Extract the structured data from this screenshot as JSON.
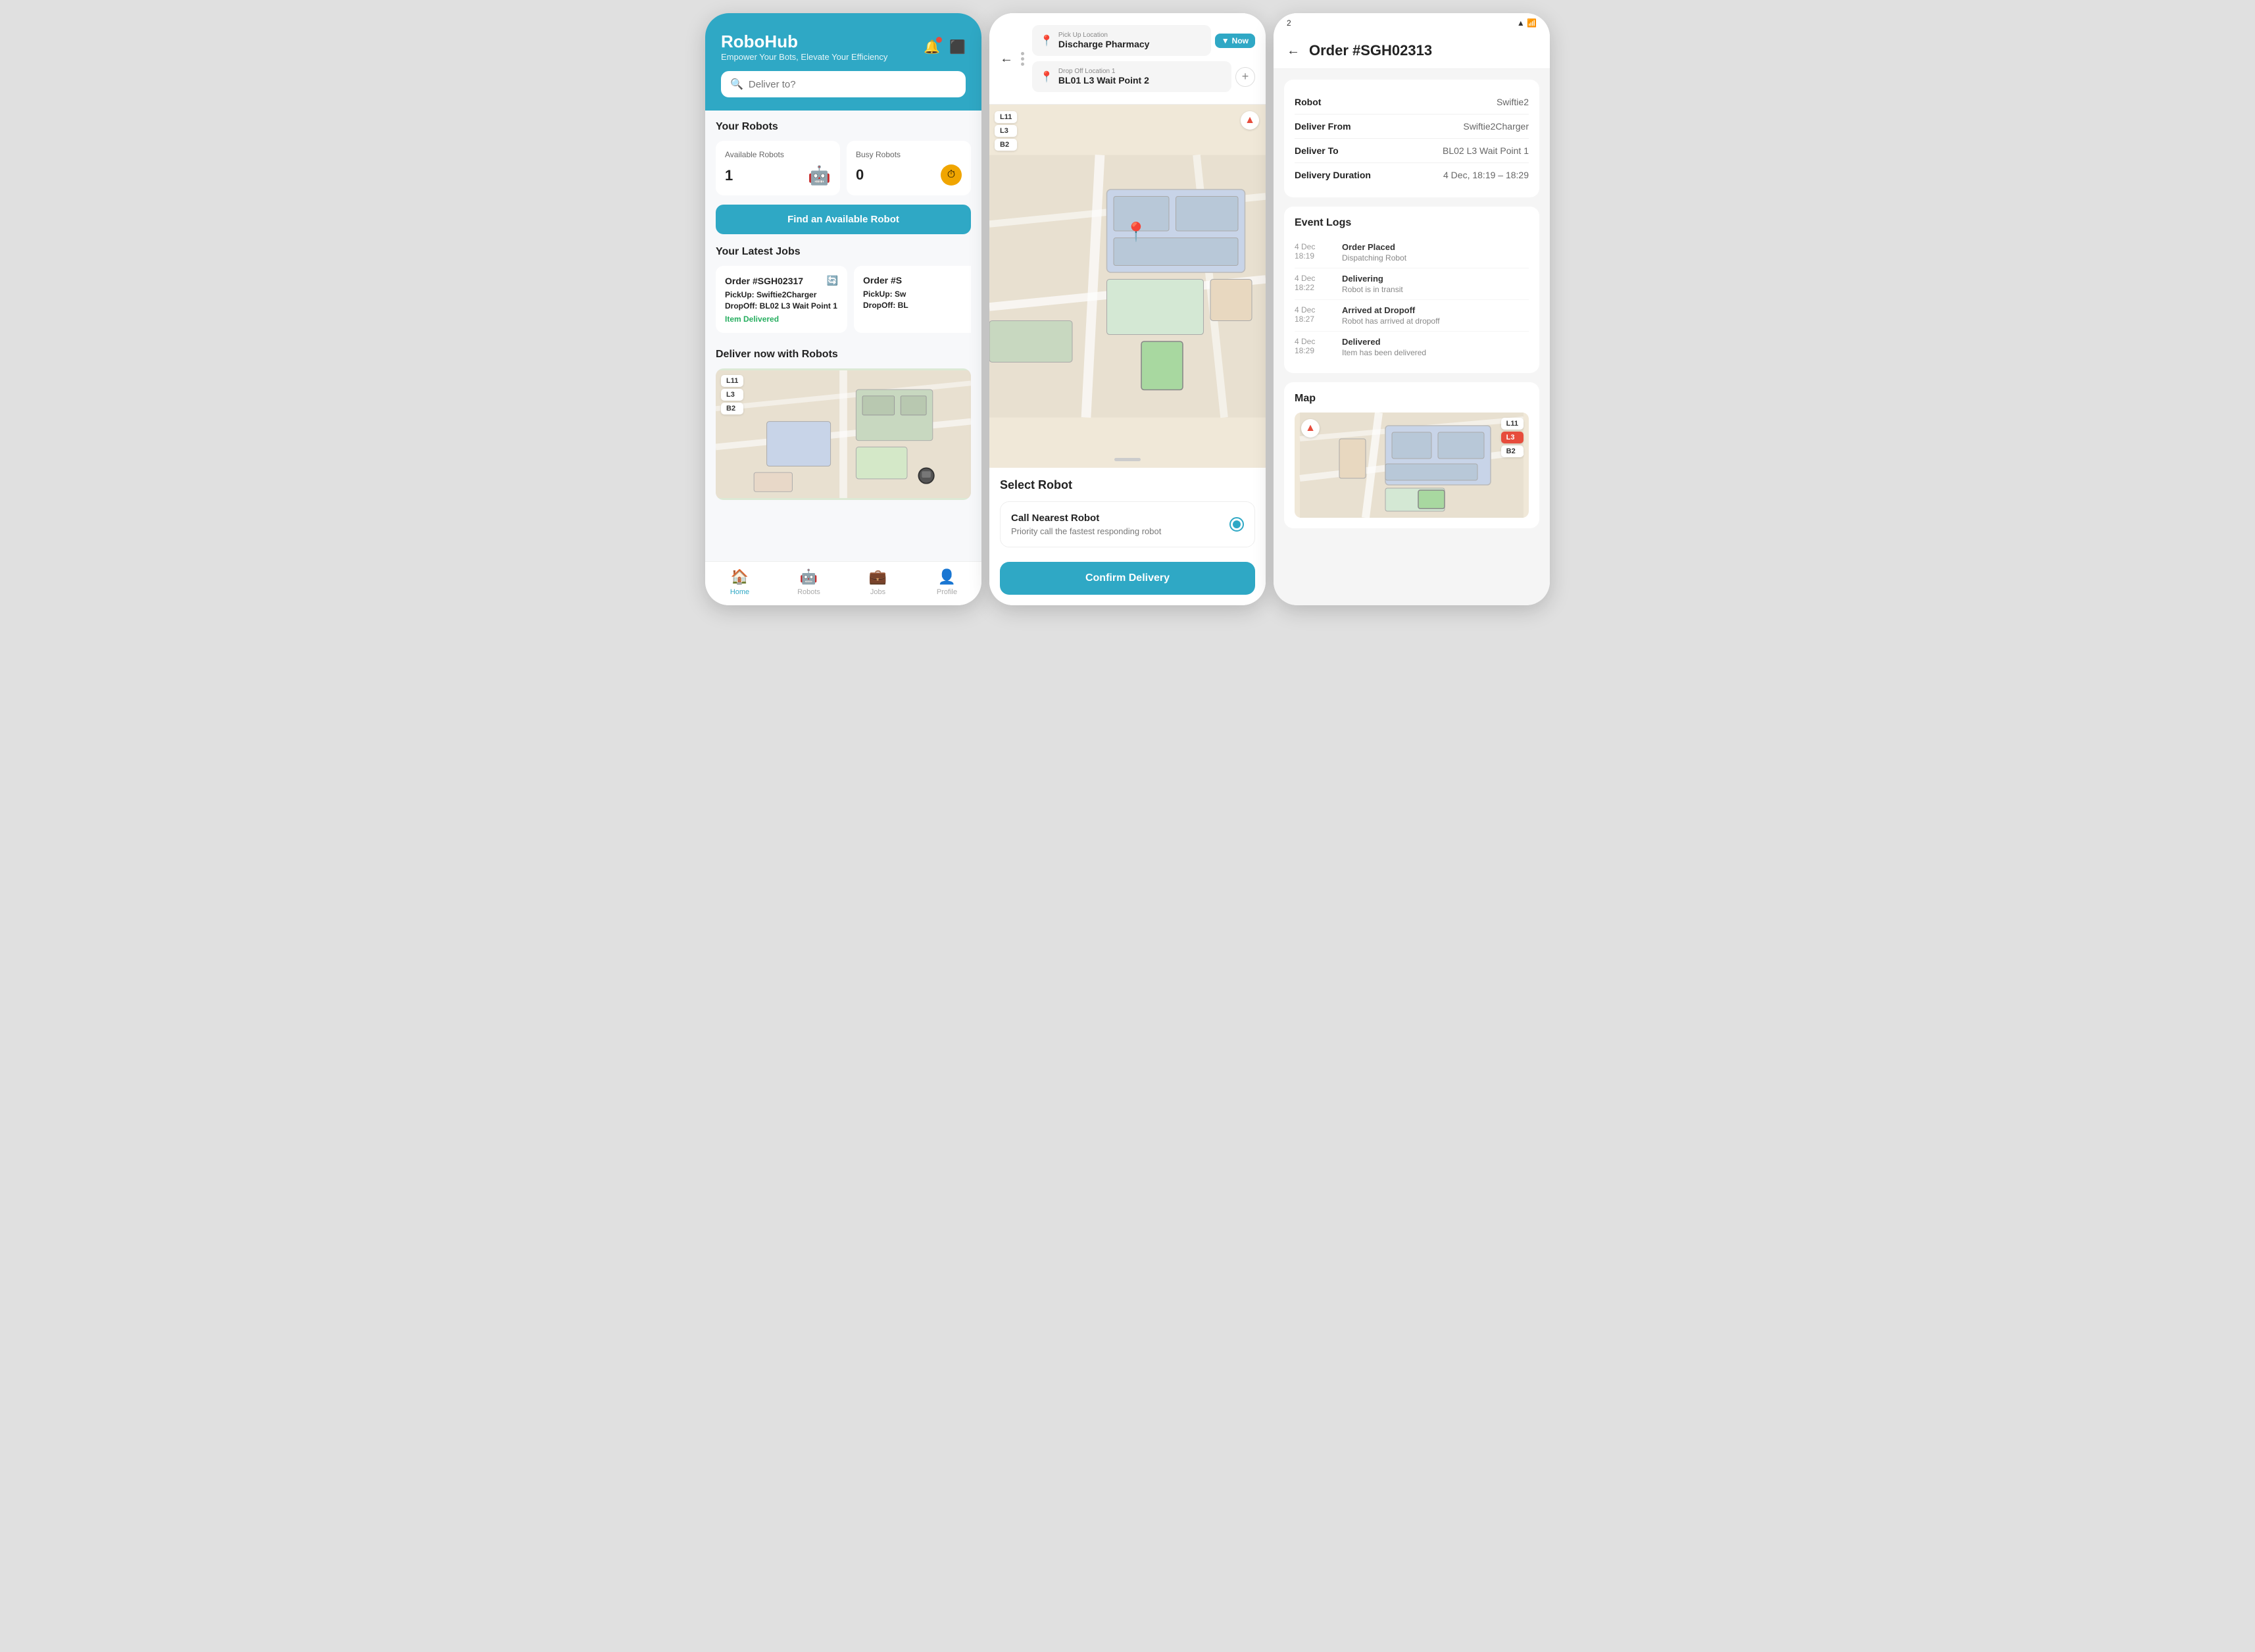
{
  "screen1": {
    "app_name": "RoboHub",
    "tagline": "Empower Your Bots, Elevate Your Efficiency",
    "search_placeholder": "Deliver to?",
    "section_robots": "Your Robots",
    "available_label": "Available Robots",
    "available_count": "1",
    "busy_label": "Busy Robots",
    "busy_count": "0",
    "find_btn": "Find an Available Robot",
    "section_jobs": "Your Latest Jobs",
    "jobs": [
      {
        "id": "Order #SGH02317",
        "pickup_label": "PickUp:",
        "pickup": "Swiftie2Charger",
        "dropoff_label": "DropOff:",
        "dropoff": "BL02 L3 Wait Point 1",
        "status": "Item Delivered"
      },
      {
        "id": "Order #S",
        "pickup_label": "PickUp:",
        "pickup": "Sw",
        "dropoff_label": "DropOff:",
        "dropoff": "BL",
        "status": ""
      }
    ],
    "section_deliver": "Deliver now with Robots",
    "nav": [
      {
        "icon": "🏠",
        "label": "Home",
        "active": true
      },
      {
        "icon": "🤖",
        "label": "Robots",
        "active": false
      },
      {
        "icon": "💼",
        "label": "Jobs",
        "active": false
      },
      {
        "icon": "👤",
        "label": "Profile",
        "active": false
      }
    ],
    "floors": [
      "L11",
      "L3",
      "B2"
    ]
  },
  "screen2": {
    "pickup_label": "Pick Up Location",
    "pickup_value": "Discharge Pharmacy",
    "now_label": "Now",
    "dropoff_label": "Drop Off Location 1",
    "dropoff_value": "BL01 L3 Wait Point 2",
    "section_title": "Select Robot",
    "robot_option_title": "Call Nearest Robot",
    "robot_option_sub": "Priority call the fastest responding robot",
    "confirm_btn": "Confirm Delivery",
    "floors": [
      "L11",
      "L3",
      "B2"
    ]
  },
  "screen3": {
    "status_time": "2",
    "order_title": "Order #SGH02313",
    "info": {
      "robot_key": "Robot",
      "robot_val": "Swiftie2",
      "from_key": "Deliver From",
      "from_val": "Swiftie2Charger",
      "to_key": "Deliver To",
      "to_val": "BL02 L3 Wait Point 1",
      "duration_key": "Delivery Duration",
      "duration_val": "4 Dec, 18:19 – 18:29"
    },
    "event_logs_title": "Event Logs",
    "events": [
      {
        "date": "4 Dec",
        "time": "18:19",
        "title": "Order Placed",
        "sub": "Dispatching Robot"
      },
      {
        "date": "4 Dec",
        "time": "18:22",
        "title": "Delivering",
        "sub": "Robot is in transit"
      },
      {
        "date": "4 Dec",
        "time": "18:27",
        "title": "Arrived at Dropoff",
        "sub": "Robot has arrived at dropoff"
      },
      {
        "date": "4 Dec",
        "time": "18:29",
        "title": "Delivered",
        "sub": "Item has been delivered"
      }
    ],
    "map_title": "Map",
    "floors": [
      "L11",
      "L3",
      "B2"
    ]
  }
}
